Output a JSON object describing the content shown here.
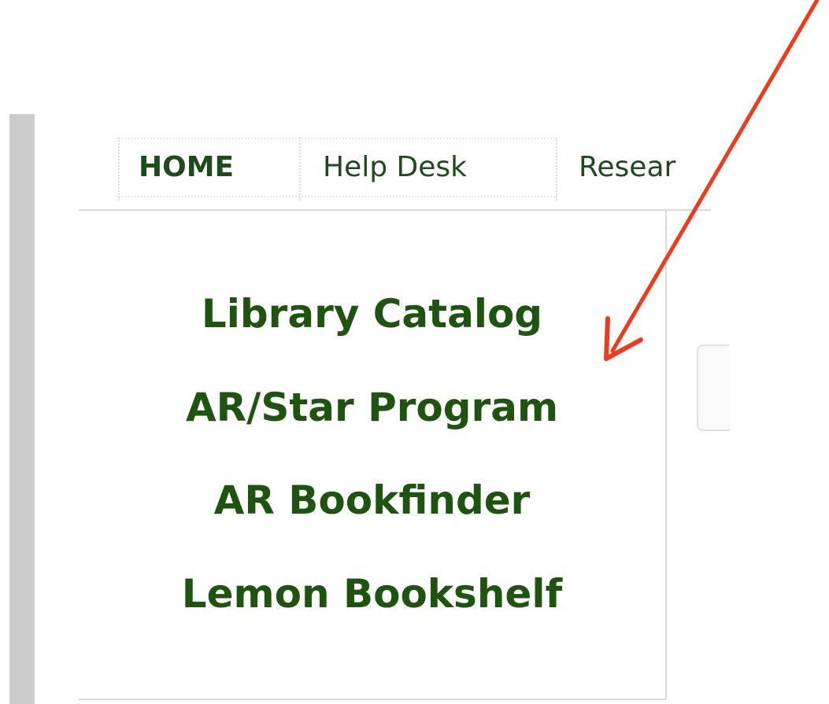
{
  "nav": {
    "items": [
      {
        "label": "HOME"
      },
      {
        "label": "Help Desk"
      },
      {
        "label": "Resear"
      }
    ]
  },
  "links": [
    {
      "label": "Library Catalog"
    },
    {
      "label": "AR/Star Program"
    },
    {
      "label": "AR Bookfinder"
    },
    {
      "label": "Lemon Bookshelf"
    }
  ],
  "colors": {
    "nav_text": "#1f4a1c",
    "link_text": "#1f5410",
    "annotation_arrow": "#f03a1e",
    "sidebar_bar": "#cccccc"
  },
  "icons": {
    "annotation": "arrow-annotation-icon"
  }
}
